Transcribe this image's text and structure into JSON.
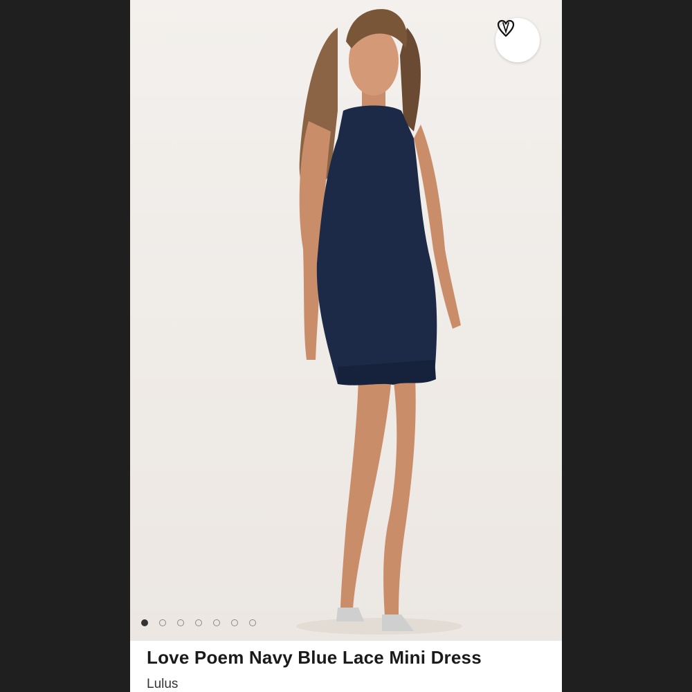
{
  "listing": {
    "title": "Love Poem Navy Blue Lace Mini Dress",
    "brand": "Lulus",
    "image_alt_subject": "model-in-navy-lace-dress",
    "carousel": {
      "total": 7,
      "active_index": 0
    },
    "like_icon": "heart-outline-icon"
  },
  "colors": {
    "background": "#1f1f1f",
    "card": "#ffffff",
    "dress": "#1c2a47",
    "accent_dot": "#333333"
  }
}
